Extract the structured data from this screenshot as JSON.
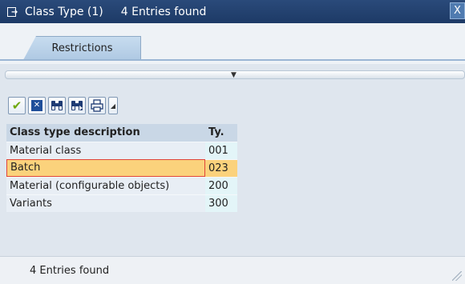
{
  "window": {
    "title": "Class Type (1)",
    "count_text": "4 Entries found",
    "close_label": "X"
  },
  "tabs": [
    {
      "label": "Restrictions",
      "active": true
    }
  ],
  "toolbar": {
    "buttons": [
      {
        "name": "confirm",
        "icon": "check-icon",
        "glyph": "✔"
      },
      {
        "name": "cancel",
        "icon": "cancel-icon",
        "glyph": "✕"
      },
      {
        "name": "find",
        "icon": "binoculars-icon",
        "glyph": "⛶"
      },
      {
        "name": "find-next",
        "icon": "binoculars-next-icon",
        "glyph": "⛶"
      },
      {
        "name": "print",
        "icon": "printer-icon",
        "glyph": "⎙"
      },
      {
        "name": "menu",
        "icon": "dropdown-arrow-icon",
        "glyph": "▾"
      }
    ]
  },
  "table": {
    "columns": [
      "Class type description",
      "Ty."
    ],
    "rows": [
      {
        "description": "Material class",
        "type": "001",
        "selected": false
      },
      {
        "description": "Batch",
        "type": "023",
        "selected": true
      },
      {
        "description": "Material (configurable objects)",
        "type": "200",
        "selected": false
      },
      {
        "description": "Variants",
        "type": "300",
        "selected": false
      }
    ]
  },
  "status": {
    "text": "4 Entries found"
  },
  "colors": {
    "titlebar": "#1d3a66",
    "selected_row": "#fbd27c",
    "selected_border": "#e0453a"
  }
}
